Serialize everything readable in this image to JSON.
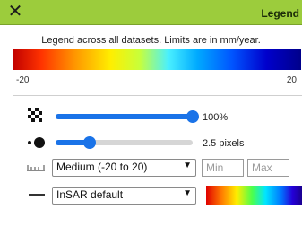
{
  "header": {
    "close_label": "✕",
    "title": "Legend"
  },
  "legend": {
    "description": "Legend across all datasets. Limits are in mm/year.",
    "min_label": "-20",
    "max_label": "20"
  },
  "opacity": {
    "icon": "checkerboard-opacity-icon",
    "value_fraction": 1.0,
    "value_label": "100%"
  },
  "point_size": {
    "icon": "point-size-icon",
    "value_fraction": 0.25,
    "value_label": "2.5 pixels"
  },
  "range": {
    "icon": "ruler-icon",
    "selected": "Medium (-20 to 20)",
    "min_placeholder": "Min",
    "max_placeholder": "Max"
  },
  "colormap": {
    "icon": "line-style-icon",
    "selected": "InSAR default"
  },
  "colors": {
    "header_bg": "#9ccc3c",
    "slider_accent": "#1a73e8"
  }
}
